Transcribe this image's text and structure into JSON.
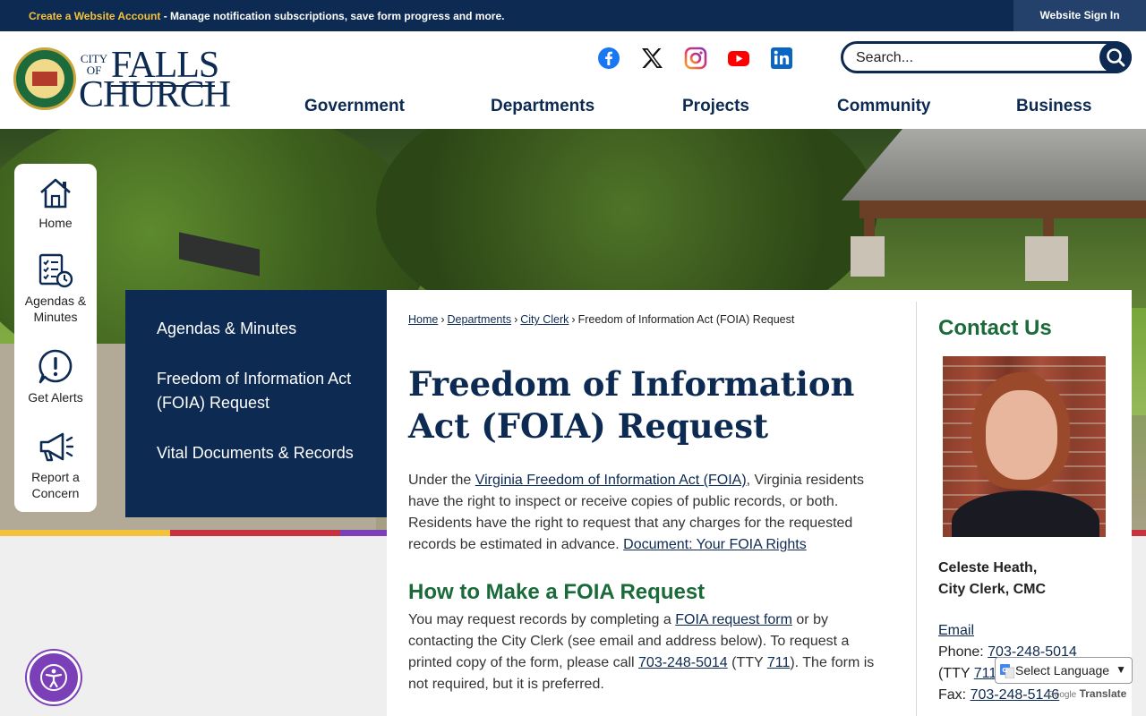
{
  "topbar": {
    "create_link": "Create a Website Account",
    "message": " - Manage notification subscriptions, save form progress and more.",
    "sign_in": "Website Sign In"
  },
  "header": {
    "logo": {
      "city": "CITY OF",
      "falls": "FALLS",
      "church": "CHURCH"
    },
    "social": [
      "facebook-icon",
      "x-icon",
      "instagram-icon",
      "youtube-icon",
      "linkedin-icon"
    ],
    "search_placeholder": "Search...",
    "nav": [
      "Government",
      "Departments",
      "Projects",
      "Community",
      "Business"
    ]
  },
  "quick_links": [
    {
      "icon": "home-icon",
      "label": "Home"
    },
    {
      "icon": "agenda-icon",
      "label": "Agendas & Minutes"
    },
    {
      "icon": "alert-icon",
      "label": "Get Alerts"
    },
    {
      "icon": "megaphone-icon",
      "label": "Report a Concern"
    }
  ],
  "sidenav": [
    "Agendas & Minutes",
    "Freedom of Information Act (FOIA) Request",
    "Vital Documents & Records"
  ],
  "breadcrumb": {
    "home": "Home",
    "departments": "Departments",
    "city_clerk": "City Clerk",
    "current": "Freedom of Information Act (FOIA) Request",
    "separator": "›"
  },
  "main": {
    "title": "Freedom of Information Act (FOIA) Request",
    "intro": {
      "p1": "Under the ",
      "link1": "Virginia Freedom of Information Act (FOIA)",
      "p2": ", Virginia residents have the right to inspect or receive copies of public records, or both. Residents have the right to request that any charges for the requested records be estimated in advance. ",
      "link2": "Document: Your FOIA Rights"
    },
    "how_title": "How to Make a FOIA Request",
    "how": {
      "p1": "You may request records by completing a ",
      "link1": "FOIA request form",
      "p2": " or by contacting the City Clerk (see email and address below). To request a printed copy of the form, please call ",
      "phone": "703-248-5014",
      "p3": " (TTY ",
      "tty": "711",
      "p4": "). The form is not required, but it is preferred."
    }
  },
  "contact": {
    "title": "Contact Us",
    "name": "Celeste Heath,",
    "role": "City Clerk, CMC",
    "email_label": "Email",
    "phone_label": "Phone: ",
    "phone": "703-248-5014",
    "tty_label": "(TTY ",
    "tty": "711",
    "fax_label": "Fax: ",
    "fax": "703-248-5146"
  },
  "translate": {
    "label": "Select Language",
    "powered_brand": "Google",
    "powered_text": "Translate"
  },
  "colors": {
    "navy": "#0d2a52",
    "green": "#1b6b3a",
    "gold": "#f4c23a",
    "purple": "#7b3fb8",
    "bar": [
      "#f4c23a",
      "#c8313f",
      "#7b3fb8",
      "#1b6b3a",
      "#1f7ab8",
      "#f4c23a",
      "#c8313f"
    ]
  }
}
